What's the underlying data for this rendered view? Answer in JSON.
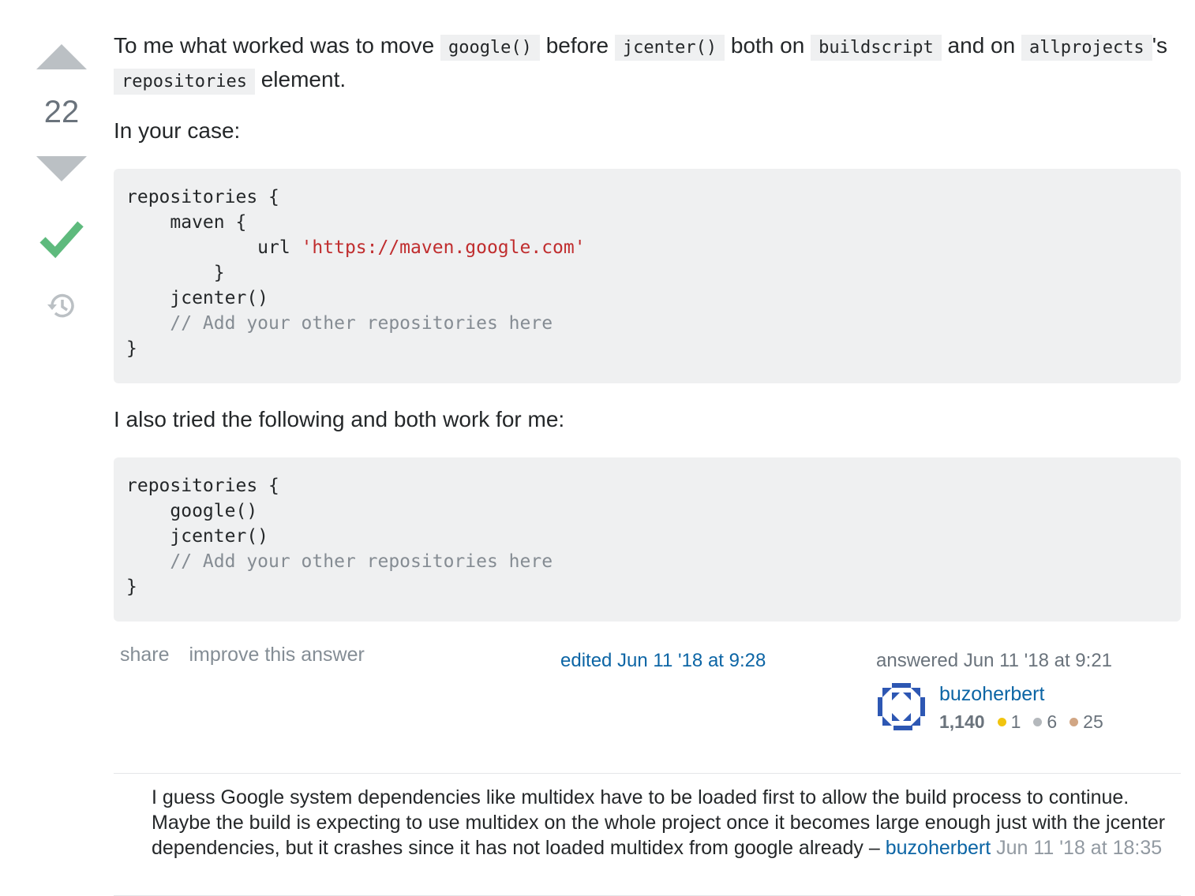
{
  "vote": {
    "count": "22"
  },
  "post": {
    "p1": {
      "t1": "To me what worked was to move ",
      "c1": "google()",
      "t2": " before ",
      "c2": "jcenter()",
      "t3": " both on ",
      "c3": "buildscript",
      "t4": " and on ",
      "c4": "allprojects",
      "t5": "'s ",
      "c5": "repositories",
      "t6": " element."
    },
    "p2": "In your case:",
    "code1": {
      "l1": "repositories {",
      "l2": "    maven {",
      "l3a": "            url ",
      "l3b": "'https://maven.google.com'",
      "l4": "        }",
      "l5": "    jcenter()",
      "l6": "    // Add your other repositories here",
      "l7": "}"
    },
    "p3": "I also tried the following and both work for me:",
    "code2": {
      "l1": "repositories {",
      "l2": "    google()",
      "l3": "    jcenter()",
      "l4": "    // Add your other repositories here",
      "l5": "}"
    }
  },
  "menu": {
    "share": "share",
    "improve": "improve this answer"
  },
  "edited": "edited Jun 11 '18 at 9:28",
  "answered": {
    "label": "answered Jun 11 '18 at 9:21",
    "user": "buzoherbert",
    "rep": "1,140",
    "gold": "1",
    "silver": "6",
    "bronze": "25",
    "colors": {
      "gold": "#f1c40f",
      "silver": "#b4b8bc",
      "bronze": "#d1a684"
    }
  },
  "comment": {
    "text": "I guess Google system dependencies like multidex have to be loaded first to allow the build process to continue. Maybe the build is expecting to use multidex on the whole project once it becomes large enough just with the jcenter dependencies, but it crashes since it has not loaded multidex from google already – ",
    "user": "buzoherbert",
    "date": "Jun 11 '18 at 18:35"
  }
}
